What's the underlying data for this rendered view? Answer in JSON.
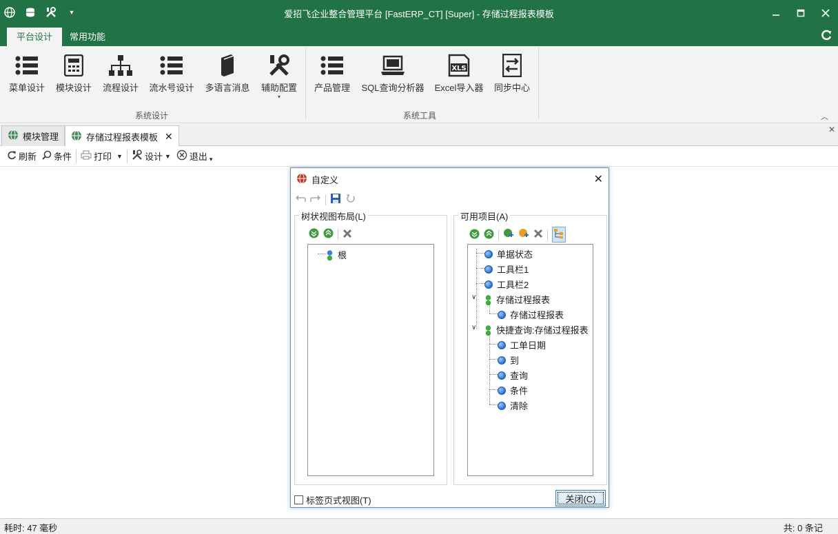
{
  "window": {
    "title": "爱招飞企业整合管理平台 [FastERP_CT] [Super] - 存储过程报表模板",
    "controls": [
      "minimize-icon",
      "maximize-icon",
      "close-icon"
    ]
  },
  "ribbon": {
    "tabs": [
      {
        "label": "平台设计",
        "active": true
      },
      {
        "label": "常用功能",
        "active": false
      }
    ],
    "groups": [
      {
        "label": "系统设计",
        "buttons": [
          "菜单设计",
          "模块设计",
          "流程设计",
          "流水号设计",
          "多语言消息",
          "辅助配置"
        ]
      },
      {
        "label": "系统工具",
        "buttons": [
          "产品管理",
          "SQL查询分析器",
          "Excel导入器",
          "同步中心"
        ]
      }
    ]
  },
  "doc_tabs": [
    {
      "label": "模块管理",
      "active": false
    },
    {
      "label": "存储过程报表模板",
      "active": true
    }
  ],
  "toolbar": {
    "refresh": "刷新",
    "filter": "条件",
    "print": "打印",
    "design": "设计",
    "exit": "退出"
  },
  "dialog": {
    "title": "自定义",
    "left_panel": {
      "legend": "树状视图布局(L)",
      "nodes": [
        "根"
      ]
    },
    "right_panel": {
      "legend": "可用项目(A)",
      "nodes": [
        "单据状态",
        "工具栏1",
        "工具栏2",
        "存储过程报表",
        "存储过程报表",
        "快捷查询:存储过程报表",
        "工单日期",
        "到",
        "查询",
        "条件",
        "清除"
      ]
    },
    "checkbox_label": "标签页式视图(T)",
    "checkbox_checked": false,
    "close_label": "关闭(C)"
  },
  "status": {
    "left": "耗时: 47 毫秒",
    "right": "共: 0 条记"
  },
  "colors": {
    "accent": "#217346",
    "dialog_border": "#5b8fc9"
  }
}
